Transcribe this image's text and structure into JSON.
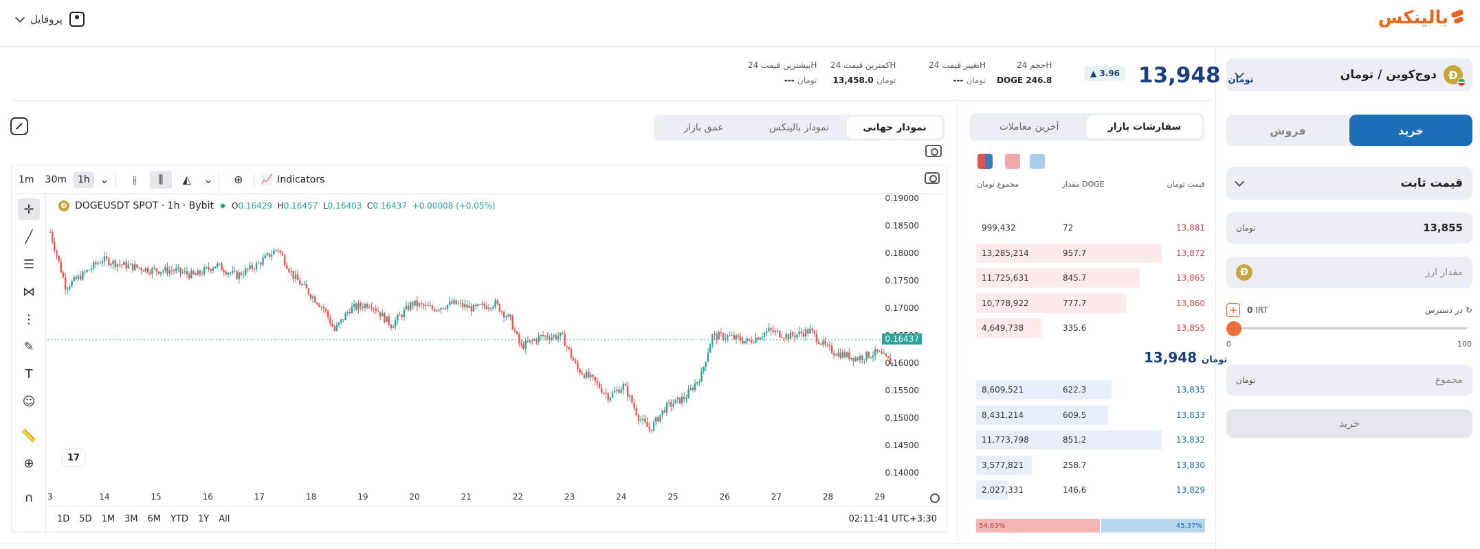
{
  "header": {
    "logo_text": "بالینکس",
    "profile_label": "پروفایل",
    "colors": {
      "brand": "#e8641b",
      "primary": "#1b6fb8",
      "price": "#1b3e7e",
      "up": "#26a69a",
      "down": "#ef5350"
    }
  },
  "trade_panel": {
    "coin_pair": "دوج‌کوین / تومان",
    "coin_icon": "Ð",
    "buy_tab": "خرید",
    "sell_tab": "فروش",
    "order_type": "قیمت ثابت",
    "price_value": "13,855",
    "currency_symbol": "تومان",
    "amount_placeholder": "مقدار ارز",
    "available_label": "در دسترس",
    "available_value": "0",
    "available_currency": "IRT",
    "slider_min": "0",
    "slider_max": "100",
    "slider_percent": 0,
    "total_placeholder": "مجموع",
    "submit_label": "خرید"
  },
  "ticker": {
    "last_price": "13,948",
    "change_badge": "3.96",
    "volume_label": "حجم 24H",
    "volume_value": "246.8",
    "volume_unit": "DOGE",
    "change_label": "تغییر قیمت 24H",
    "change_value": "---",
    "low_label": "کمترین قیمت 24H",
    "low_value": "13,458.0",
    "high_label": "بیشترین قیمت 24H",
    "high_value": "---"
  },
  "chart_tabs": [
    "نمودار جهانی",
    "نمودار بالینکس",
    "عمق بازار"
  ],
  "toolbar": {
    "timeframes": [
      "1m",
      "30m",
      "1h"
    ],
    "active_timeframe": "1h",
    "indicators_label": "Indicators"
  },
  "chart_info": {
    "symbol": "DOGEUSDT SPOT · 1h · Bybit",
    "o_label": "O",
    "o": "0.16429",
    "h_label": "H",
    "h": "0.16457",
    "l_label": "L",
    "l": "0.16403",
    "c_label": "C",
    "c": "0.16437",
    "change": "+0.00008 (+0.05%)",
    "current_price_tag": "0.16437"
  },
  "chart_data": {
    "type": "candlestick",
    "x_ticks": [
      "3",
      "14",
      "15",
      "16",
      "17",
      "18",
      "19",
      "20",
      "21",
      "22",
      "23",
      "24",
      "25",
      "26",
      "27",
      "28",
      "29"
    ],
    "y_ticks": [
      "0.19000",
      "0.18500",
      "0.18000",
      "0.17500",
      "0.17000",
      "0.16500",
      "0.16000",
      "0.15500",
      "0.15000",
      "0.14500",
      "0.14000"
    ],
    "ylim": [
      0.14,
      0.19
    ],
    "close_path": [
      [
        0,
        0.184
      ],
      [
        0.3,
        0.174
      ],
      [
        0.6,
        0.176
      ],
      [
        1.0,
        0.179
      ],
      [
        1.4,
        0.178
      ],
      [
        2.0,
        0.177
      ],
      [
        2.4,
        0.177
      ],
      [
        2.8,
        0.176
      ],
      [
        3.2,
        0.178
      ],
      [
        3.6,
        0.176
      ],
      [
        4.0,
        0.178
      ],
      [
        4.4,
        0.181
      ],
      [
        4.7,
        0.176
      ],
      [
        5.0,
        0.173
      ],
      [
        5.3,
        0.17
      ],
      [
        5.5,
        0.166
      ],
      [
        5.8,
        0.17
      ],
      [
        6.2,
        0.171
      ],
      [
        6.6,
        0.167
      ],
      [
        7.0,
        0.171
      ],
      [
        7.4,
        0.17
      ],
      [
        7.8,
        0.171
      ],
      [
        8.2,
        0.17
      ],
      [
        8.6,
        0.171
      ],
      [
        8.9,
        0.168
      ],
      [
        9.1,
        0.163
      ],
      [
        9.5,
        0.165
      ],
      [
        9.9,
        0.165
      ],
      [
        10.2,
        0.159
      ],
      [
        10.5,
        0.157
      ],
      [
        10.8,
        0.154
      ],
      [
        11.1,
        0.156
      ],
      [
        11.4,
        0.15
      ],
      [
        11.6,
        0.148
      ],
      [
        11.9,
        0.152
      ],
      [
        12.3,
        0.154
      ],
      [
        12.6,
        0.158
      ],
      [
        12.8,
        0.165
      ],
      [
        13.1,
        0.165
      ],
      [
        13.5,
        0.164
      ],
      [
        13.9,
        0.166
      ],
      [
        14.3,
        0.165
      ],
      [
        14.7,
        0.166
      ],
      [
        15.0,
        0.163
      ],
      [
        15.2,
        0.162
      ],
      [
        15.6,
        0.161
      ],
      [
        16.0,
        0.162
      ],
      [
        16.3,
        0.16
      ],
      [
        16.7,
        0.162
      ],
      [
        17.0,
        0.163
      ],
      [
        17.4,
        0.164
      ],
      [
        17.6,
        0.1644
      ]
    ]
  },
  "range_bar": {
    "ranges": [
      "1D",
      "5D",
      "1M",
      "3M",
      "6M",
      "YTD",
      "1Y",
      "All"
    ],
    "clock": "02:11:41 UTC+3:30"
  },
  "order_book": {
    "tabs": [
      "سفارشات بازار",
      "آخرین معاملات"
    ],
    "col_price": "قیمت",
    "col_amount": "مقدار DOGE",
    "col_total": "مجموع",
    "asks": [
      {
        "price": "13,881",
        "amount": "72",
        "total": "999,432",
        "depth": 0
      },
      {
        "price": "13,872",
        "amount": "957.7",
        "total": "13,285,214",
        "depth": 1.0
      },
      {
        "price": "13,865",
        "amount": "845.7",
        "total": "11,725,631",
        "depth": 0.88
      },
      {
        "price": "13,860",
        "amount": "777.7",
        "total": "10,778,922",
        "depth": 0.81
      },
      {
        "price": "13,855",
        "amount": "335.6",
        "total": "4,649,738",
        "depth": 0.35
      }
    ],
    "mid_price": "13,948",
    "bids": [
      {
        "price": "13,835",
        "amount": "622.3",
        "total": "8,609,521",
        "depth": 0.73
      },
      {
        "price": "13,833",
        "amount": "609.5",
        "total": "8,431,214",
        "depth": 0.71
      },
      {
        "price": "13,832",
        "amount": "851.2",
        "total": "11,773,798",
        "depth": 1.0
      },
      {
        "price": "13,830",
        "amount": "258.7",
        "total": "3,577,821",
        "depth": 0.3
      },
      {
        "price": "13,829",
        "amount": "146.6",
        "total": "2,027,331",
        "depth": 0.17
      }
    ],
    "sell_ratio": "54.63%",
    "buy_ratio": "45.37%"
  }
}
